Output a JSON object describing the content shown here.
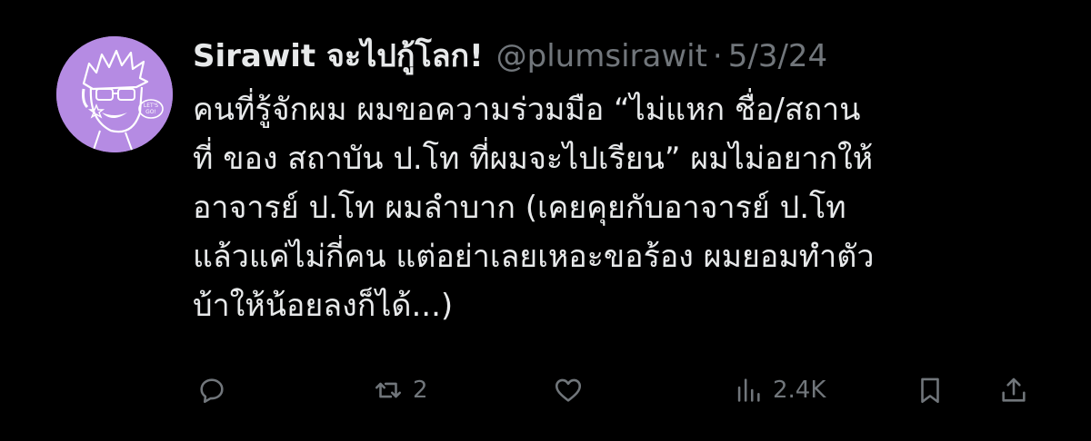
{
  "tweet": {
    "display_name": "Sirawit จะไปกู้โลก!",
    "handle": "@plumsirawit",
    "separator": "·",
    "date": "5/3/24",
    "text_lines": [
      "คนที่รู้จักผม ผมขอความร่วมมือ “ไม่แหก ชื่อ/สถาน",
      "ที่ ของ สถาบัน ป.โท ที่ผมจะไปเรียน” ผมไม่อยากให้",
      "อาจารย์ ป.โท ผมลำบาก (เคยคุยกับอาจารย์ ป.โท",
      "แล้วแค่ไม่กี่คน แต่อย่าเลยเหอะขอร้อง ผมยอมทำตัว",
      "บ้าให้น้อยลงก็ได้...)"
    ],
    "avatar": {
      "icon": "avatar-illustration",
      "background_color": "#b58be3",
      "label": "LET'S GO!"
    },
    "actions": {
      "reply": {
        "icon": "reply-icon"
      },
      "retweet": {
        "icon": "retweet-icon",
        "count": "2"
      },
      "like": {
        "icon": "heart-icon"
      },
      "views": {
        "icon": "views-icon",
        "count": "2.4K"
      },
      "bookmark": {
        "icon": "bookmark-icon"
      },
      "share": {
        "icon": "share-icon"
      }
    }
  },
  "colors": {
    "background": "#000000",
    "text_primary": "#e7e9ea",
    "text_secondary": "#71767b",
    "avatar_bg": "#b58be3"
  }
}
